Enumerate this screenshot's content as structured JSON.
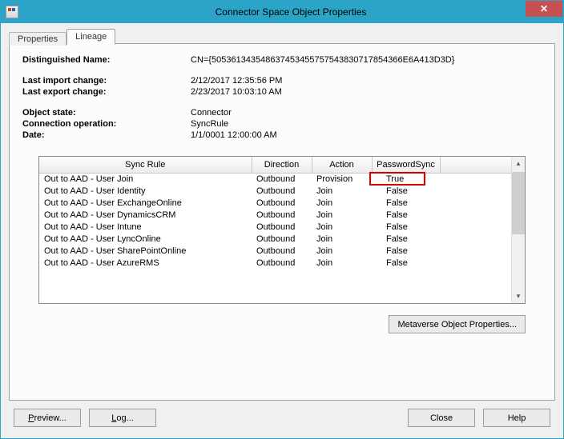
{
  "window": {
    "title": "Connector Space Object Properties"
  },
  "tabs": {
    "properties": "Properties",
    "lineage": "Lineage"
  },
  "fields": {
    "dn_label": "Distinguished Name:",
    "dn_value": "CN={505361343548637453455757543830717854366E6A413D3D}",
    "last_import_label": "Last import change:",
    "last_import_value": "2/12/2017 12:35:56 PM",
    "last_export_label": "Last export change:",
    "last_export_value": "2/23/2017 10:03:10 AM",
    "object_state_label": "Object state:",
    "object_state_value": "Connector",
    "conn_op_label": "Connection operation:",
    "conn_op_value": "SyncRule",
    "date_label": "Date:",
    "date_value": "1/1/0001 12:00:00 AM"
  },
  "columns": {
    "rule": "Sync Rule",
    "direction": "Direction",
    "action": "Action",
    "pwsync": "PasswordSync"
  },
  "rows": [
    {
      "rule": "Out to AAD - User Join",
      "direction": "Outbound",
      "action": "Provision",
      "pwsync": "True"
    },
    {
      "rule": "Out to AAD - User Identity",
      "direction": "Outbound",
      "action": "Join",
      "pwsync": "False"
    },
    {
      "rule": "Out to AAD - User ExchangeOnline",
      "direction": "Outbound",
      "action": "Join",
      "pwsync": "False"
    },
    {
      "rule": "Out to AAD - User DynamicsCRM",
      "direction": "Outbound",
      "action": "Join",
      "pwsync": "False"
    },
    {
      "rule": "Out to AAD - User Intune",
      "direction": "Outbound",
      "action": "Join",
      "pwsync": "False"
    },
    {
      "rule": "Out to AAD - User LyncOnline",
      "direction": "Outbound",
      "action": "Join",
      "pwsync": "False"
    },
    {
      "rule": "Out to AAD - User SharePointOnline",
      "direction": "Outbound",
      "action": "Join",
      "pwsync": "False"
    },
    {
      "rule": "Out to AAD - User AzureRMS",
      "direction": "Outbound",
      "action": "Join",
      "pwsync": "False"
    }
  ],
  "buttons": {
    "metaverse": "Metaverse Object Properties...",
    "preview": "Preview...",
    "log": "Log...",
    "close": "Close",
    "help": "Help"
  },
  "highlight": {
    "row": 0,
    "column": "pwsync"
  }
}
